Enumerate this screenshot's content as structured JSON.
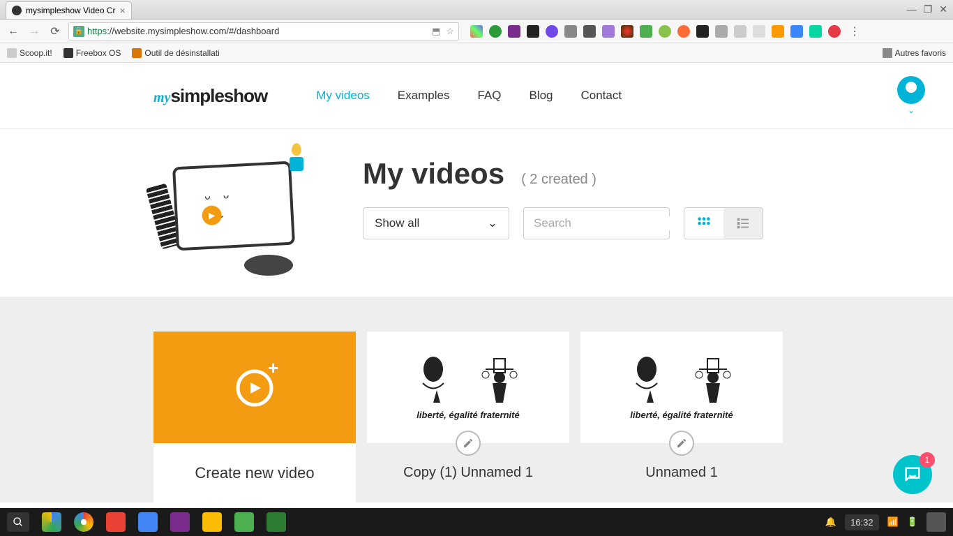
{
  "window": {
    "tab_title": "mysimpleshow Video Cr",
    "minimize": "—",
    "maximize": "❐",
    "close": "✕"
  },
  "browser": {
    "url_proto": "https",
    "url_rest": "://website.mysimpleshow.com/#/dashboard",
    "bookmarks": [
      {
        "label": "Scoop.it!"
      },
      {
        "label": "Freebox OS"
      },
      {
        "label": "Outil de désinstallati"
      }
    ],
    "other_bookmarks": "Autres favoris"
  },
  "logo": {
    "my": "my",
    "simpleshow": "simpleshow"
  },
  "nav": {
    "my_videos": "My videos",
    "examples": "Examples",
    "faq": "FAQ",
    "blog": "Blog",
    "contact": "Contact"
  },
  "hero": {
    "title": "My videos",
    "count": "( 2 created )",
    "filter_label": "Show all",
    "search_placeholder": "Search"
  },
  "create_card": {
    "label": "Create new video"
  },
  "videos": [
    {
      "caption": "liberté, égalité fraternité",
      "title": "Copy (1) Unnamed 1"
    },
    {
      "caption": "liberté, égalité fraternité",
      "title": "Unnamed 1"
    }
  ],
  "chat": {
    "badge": "1"
  },
  "taskbar": {
    "clock": "16:32"
  }
}
